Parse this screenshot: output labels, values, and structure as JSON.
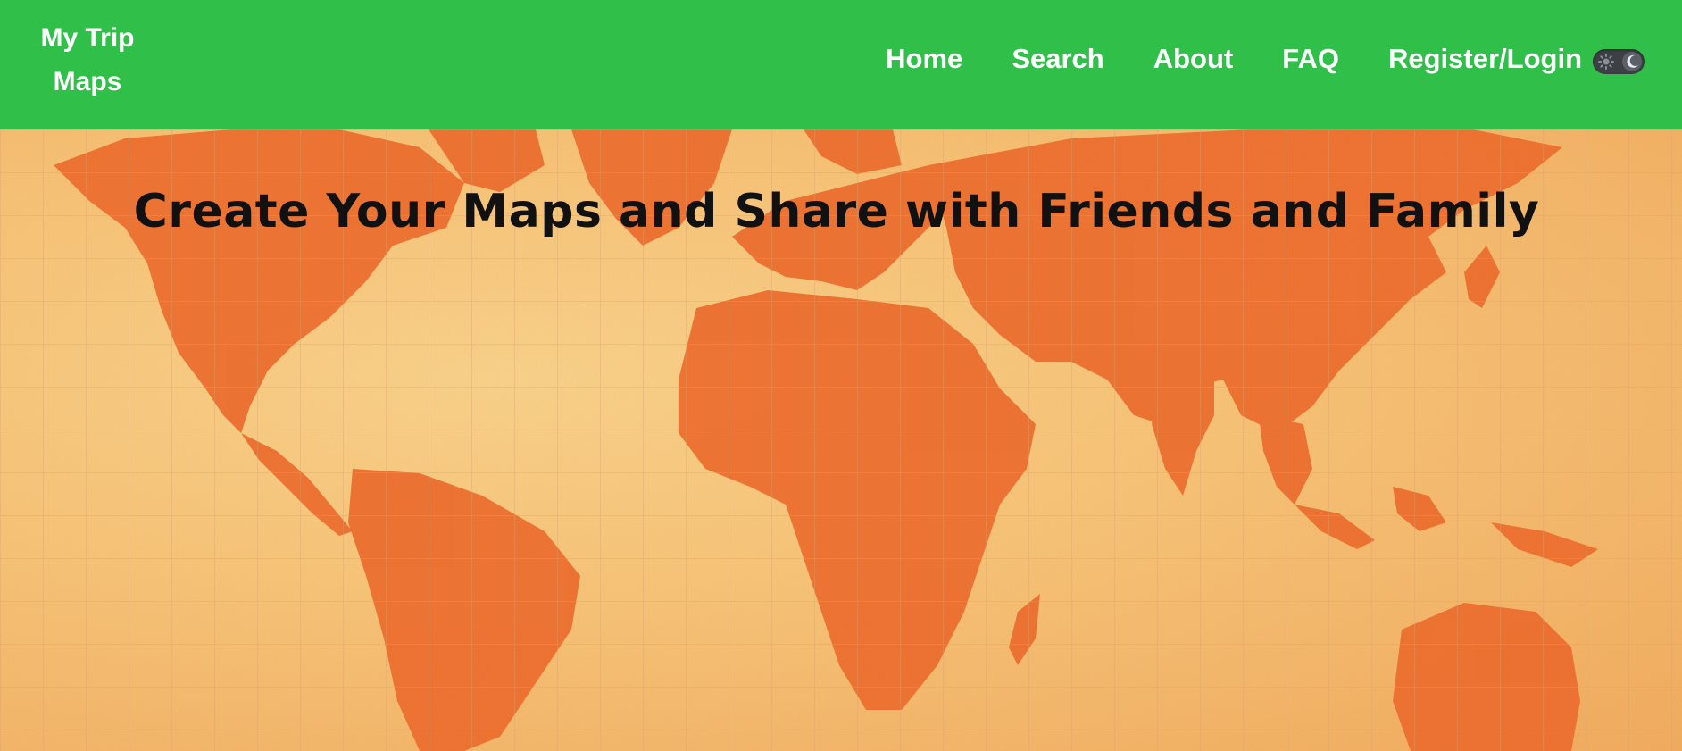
{
  "brand": {
    "line1": "My Trip",
    "line2": "Maps"
  },
  "nav": {
    "items": [
      {
        "label": "Home"
      },
      {
        "label": "Search"
      },
      {
        "label": "About"
      },
      {
        "label": "FAQ"
      },
      {
        "label": "Register/Login"
      }
    ]
  },
  "theme_toggle": {
    "left_icon": "sun-icon",
    "right_icon": "moon-icon",
    "state": "dark"
  },
  "hero": {
    "title": "Create Your Maps and Share with Friends and Family",
    "background": "world-map"
  },
  "colors": {
    "navbar": "#30c04a",
    "nav_text": "#ffffff",
    "map_land": "#ee6a2c",
    "map_paper": "#f8c57a",
    "title_text": "#111111"
  }
}
